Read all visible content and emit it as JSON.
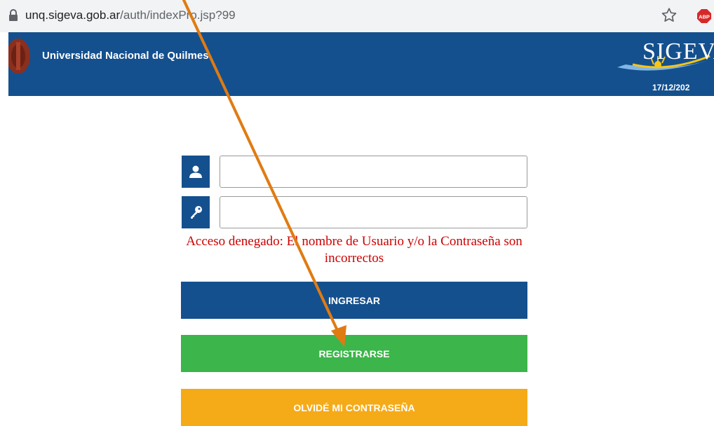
{
  "browser": {
    "url_host": "unq.sigeva.gob.ar",
    "url_path": "/auth/indexPro.jsp?99",
    "star_icon": "bookmark-star-icon",
    "extension_label": "ABP"
  },
  "header": {
    "university_name": "Universidad Nacional de Quilmes",
    "app_logo_text": "SIGEVA",
    "date": "17/12/202",
    "band_color": "#14508e"
  },
  "login": {
    "user_icon": "user-icon",
    "password_icon": "key-icon",
    "username_value": "",
    "password_value": "",
    "error_message": "Acceso denegado: El nombre de Usuario y/o la Contraseña son incorrectos",
    "error_color": "#cc0000",
    "ingresar_label": "INGRESAR",
    "registrarse_label": "REGISTRARSE",
    "olvide_label": "OLVIDÉ MI CONTRASEÑA",
    "ingresar_color": "#14508e",
    "registrarse_color": "#3cb54a",
    "olvide_color": "#f5aa17"
  },
  "annotation": {
    "arrow_color": "#e07b12",
    "arrow_target": "registrarse-button"
  }
}
